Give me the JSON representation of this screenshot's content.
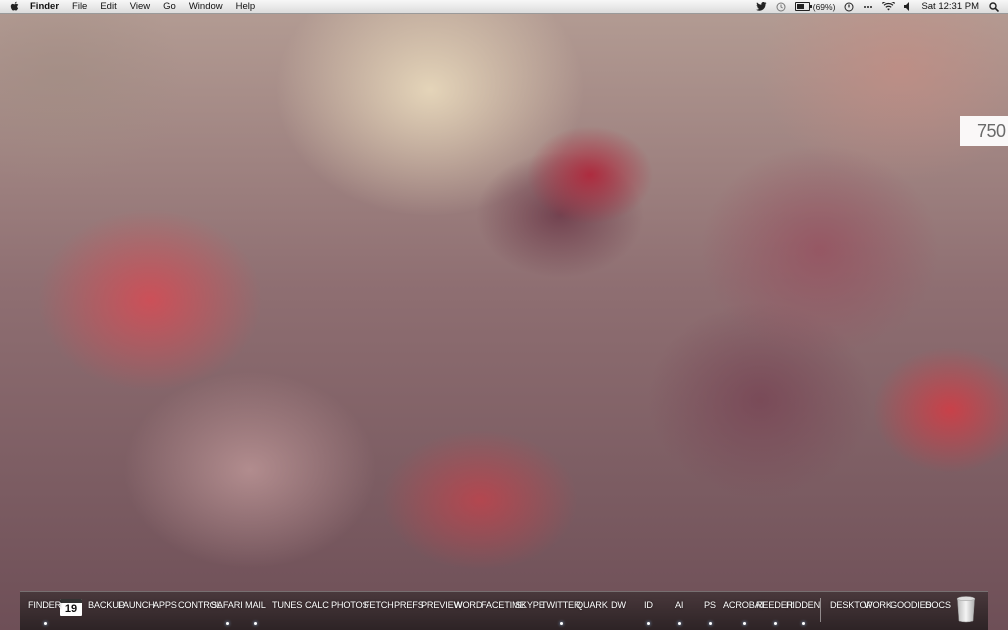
{
  "menubar": {
    "app_name": "Finder",
    "menus": [
      "File",
      "Edit",
      "View",
      "Go",
      "Window",
      "Help"
    ],
    "battery_text": "(69%)",
    "battery_level": 0.69,
    "clock": "Sat 12:31 PM"
  },
  "widget": {
    "value": "750"
  },
  "dock": {
    "calendar_day": "19",
    "items": [
      {
        "label": "FINDER",
        "running": true
      },
      {
        "label": "BACKUP",
        "running": false
      },
      {
        "label": "LAUNCH",
        "running": false
      },
      {
        "label": "APPS",
        "running": false
      },
      {
        "label": "CONTROL",
        "running": false
      },
      {
        "label": "SAFARI",
        "running": true
      },
      {
        "label": "MAIL",
        "running": true
      },
      {
        "label": "TUNES",
        "running": false
      },
      {
        "label": "CALC",
        "running": false
      },
      {
        "label": "PHOTOS",
        "running": false
      },
      {
        "label": "FETCH",
        "running": false
      },
      {
        "label": "PREFS",
        "running": false
      },
      {
        "label": "PREVIEW",
        "running": false
      },
      {
        "label": "WORD",
        "running": false
      },
      {
        "label": "FACETIME",
        "running": false
      },
      {
        "label": "SKYPE",
        "running": false
      },
      {
        "label": "TWITTER",
        "running": true
      },
      {
        "label": "QUARK",
        "running": false
      },
      {
        "label": "DW",
        "running": false
      },
      {
        "label": "ID",
        "running": true
      },
      {
        "label": "AI",
        "running": true
      },
      {
        "label": "PS",
        "running": true
      },
      {
        "label": "ACROBAT",
        "running": true
      },
      {
        "label": "REEDER",
        "running": true
      },
      {
        "label": "HIDDEN",
        "running": true
      }
    ],
    "stacks": [
      {
        "label": "DESKTOP"
      },
      {
        "label": "WORK"
      },
      {
        "label": "GOODIES"
      },
      {
        "label": "DOCS"
      }
    ]
  },
  "icons": {
    "apple": "apple-icon",
    "twitter": "twitter-bird-icon",
    "timemachine": "time-machine-icon",
    "battery": "battery-icon",
    "wifi": "wifi-icon",
    "volume": "volume-icon",
    "spotlight": "spotlight-search-icon",
    "calendar": "calendar-icon",
    "trash": "trash-icon"
  }
}
